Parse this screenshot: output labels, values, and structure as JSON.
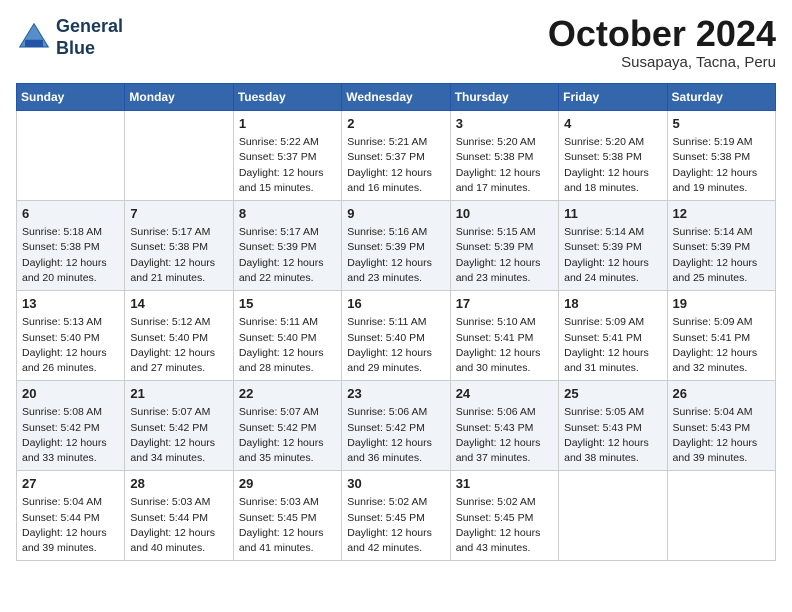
{
  "header": {
    "logo_line1": "General",
    "logo_line2": "Blue",
    "month": "October 2024",
    "location": "Susapaya, Tacna, Peru"
  },
  "weekdays": [
    "Sunday",
    "Monday",
    "Tuesday",
    "Wednesday",
    "Thursday",
    "Friday",
    "Saturday"
  ],
  "weeks": [
    [
      {
        "day": "",
        "info": ""
      },
      {
        "day": "",
        "info": ""
      },
      {
        "day": "1",
        "sunrise": "Sunrise: 5:22 AM",
        "sunset": "Sunset: 5:37 PM",
        "daylight": "Daylight: 12 hours and 15 minutes."
      },
      {
        "day": "2",
        "sunrise": "Sunrise: 5:21 AM",
        "sunset": "Sunset: 5:37 PM",
        "daylight": "Daylight: 12 hours and 16 minutes."
      },
      {
        "day": "3",
        "sunrise": "Sunrise: 5:20 AM",
        "sunset": "Sunset: 5:38 PM",
        "daylight": "Daylight: 12 hours and 17 minutes."
      },
      {
        "day": "4",
        "sunrise": "Sunrise: 5:20 AM",
        "sunset": "Sunset: 5:38 PM",
        "daylight": "Daylight: 12 hours and 18 minutes."
      },
      {
        "day": "5",
        "sunrise": "Sunrise: 5:19 AM",
        "sunset": "Sunset: 5:38 PM",
        "daylight": "Daylight: 12 hours and 19 minutes."
      }
    ],
    [
      {
        "day": "6",
        "sunrise": "Sunrise: 5:18 AM",
        "sunset": "Sunset: 5:38 PM",
        "daylight": "Daylight: 12 hours and 20 minutes."
      },
      {
        "day": "7",
        "sunrise": "Sunrise: 5:17 AM",
        "sunset": "Sunset: 5:38 PM",
        "daylight": "Daylight: 12 hours and 21 minutes."
      },
      {
        "day": "8",
        "sunrise": "Sunrise: 5:17 AM",
        "sunset": "Sunset: 5:39 PM",
        "daylight": "Daylight: 12 hours and 22 minutes."
      },
      {
        "day": "9",
        "sunrise": "Sunrise: 5:16 AM",
        "sunset": "Sunset: 5:39 PM",
        "daylight": "Daylight: 12 hours and 23 minutes."
      },
      {
        "day": "10",
        "sunrise": "Sunrise: 5:15 AM",
        "sunset": "Sunset: 5:39 PM",
        "daylight": "Daylight: 12 hours and 23 minutes."
      },
      {
        "day": "11",
        "sunrise": "Sunrise: 5:14 AM",
        "sunset": "Sunset: 5:39 PM",
        "daylight": "Daylight: 12 hours and 24 minutes."
      },
      {
        "day": "12",
        "sunrise": "Sunrise: 5:14 AM",
        "sunset": "Sunset: 5:39 PM",
        "daylight": "Daylight: 12 hours and 25 minutes."
      }
    ],
    [
      {
        "day": "13",
        "sunrise": "Sunrise: 5:13 AM",
        "sunset": "Sunset: 5:40 PM",
        "daylight": "Daylight: 12 hours and 26 minutes."
      },
      {
        "day": "14",
        "sunrise": "Sunrise: 5:12 AM",
        "sunset": "Sunset: 5:40 PM",
        "daylight": "Daylight: 12 hours and 27 minutes."
      },
      {
        "day": "15",
        "sunrise": "Sunrise: 5:11 AM",
        "sunset": "Sunset: 5:40 PM",
        "daylight": "Daylight: 12 hours and 28 minutes."
      },
      {
        "day": "16",
        "sunrise": "Sunrise: 5:11 AM",
        "sunset": "Sunset: 5:40 PM",
        "daylight": "Daylight: 12 hours and 29 minutes."
      },
      {
        "day": "17",
        "sunrise": "Sunrise: 5:10 AM",
        "sunset": "Sunset: 5:41 PM",
        "daylight": "Daylight: 12 hours and 30 minutes."
      },
      {
        "day": "18",
        "sunrise": "Sunrise: 5:09 AM",
        "sunset": "Sunset: 5:41 PM",
        "daylight": "Daylight: 12 hours and 31 minutes."
      },
      {
        "day": "19",
        "sunrise": "Sunrise: 5:09 AM",
        "sunset": "Sunset: 5:41 PM",
        "daylight": "Daylight: 12 hours and 32 minutes."
      }
    ],
    [
      {
        "day": "20",
        "sunrise": "Sunrise: 5:08 AM",
        "sunset": "Sunset: 5:42 PM",
        "daylight": "Daylight: 12 hours and 33 minutes."
      },
      {
        "day": "21",
        "sunrise": "Sunrise: 5:07 AM",
        "sunset": "Sunset: 5:42 PM",
        "daylight": "Daylight: 12 hours and 34 minutes."
      },
      {
        "day": "22",
        "sunrise": "Sunrise: 5:07 AM",
        "sunset": "Sunset: 5:42 PM",
        "daylight": "Daylight: 12 hours and 35 minutes."
      },
      {
        "day": "23",
        "sunrise": "Sunrise: 5:06 AM",
        "sunset": "Sunset: 5:42 PM",
        "daylight": "Daylight: 12 hours and 36 minutes."
      },
      {
        "day": "24",
        "sunrise": "Sunrise: 5:06 AM",
        "sunset": "Sunset: 5:43 PM",
        "daylight": "Daylight: 12 hours and 37 minutes."
      },
      {
        "day": "25",
        "sunrise": "Sunrise: 5:05 AM",
        "sunset": "Sunset: 5:43 PM",
        "daylight": "Daylight: 12 hours and 38 minutes."
      },
      {
        "day": "26",
        "sunrise": "Sunrise: 5:04 AM",
        "sunset": "Sunset: 5:43 PM",
        "daylight": "Daylight: 12 hours and 39 minutes."
      }
    ],
    [
      {
        "day": "27",
        "sunrise": "Sunrise: 5:04 AM",
        "sunset": "Sunset: 5:44 PM",
        "daylight": "Daylight: 12 hours and 39 minutes."
      },
      {
        "day": "28",
        "sunrise": "Sunrise: 5:03 AM",
        "sunset": "Sunset: 5:44 PM",
        "daylight": "Daylight: 12 hours and 40 minutes."
      },
      {
        "day": "29",
        "sunrise": "Sunrise: 5:03 AM",
        "sunset": "Sunset: 5:45 PM",
        "daylight": "Daylight: 12 hours and 41 minutes."
      },
      {
        "day": "30",
        "sunrise": "Sunrise: 5:02 AM",
        "sunset": "Sunset: 5:45 PM",
        "daylight": "Daylight: 12 hours and 42 minutes."
      },
      {
        "day": "31",
        "sunrise": "Sunrise: 5:02 AM",
        "sunset": "Sunset: 5:45 PM",
        "daylight": "Daylight: 12 hours and 43 minutes."
      },
      {
        "day": "",
        "info": ""
      },
      {
        "day": "",
        "info": ""
      }
    ]
  ]
}
